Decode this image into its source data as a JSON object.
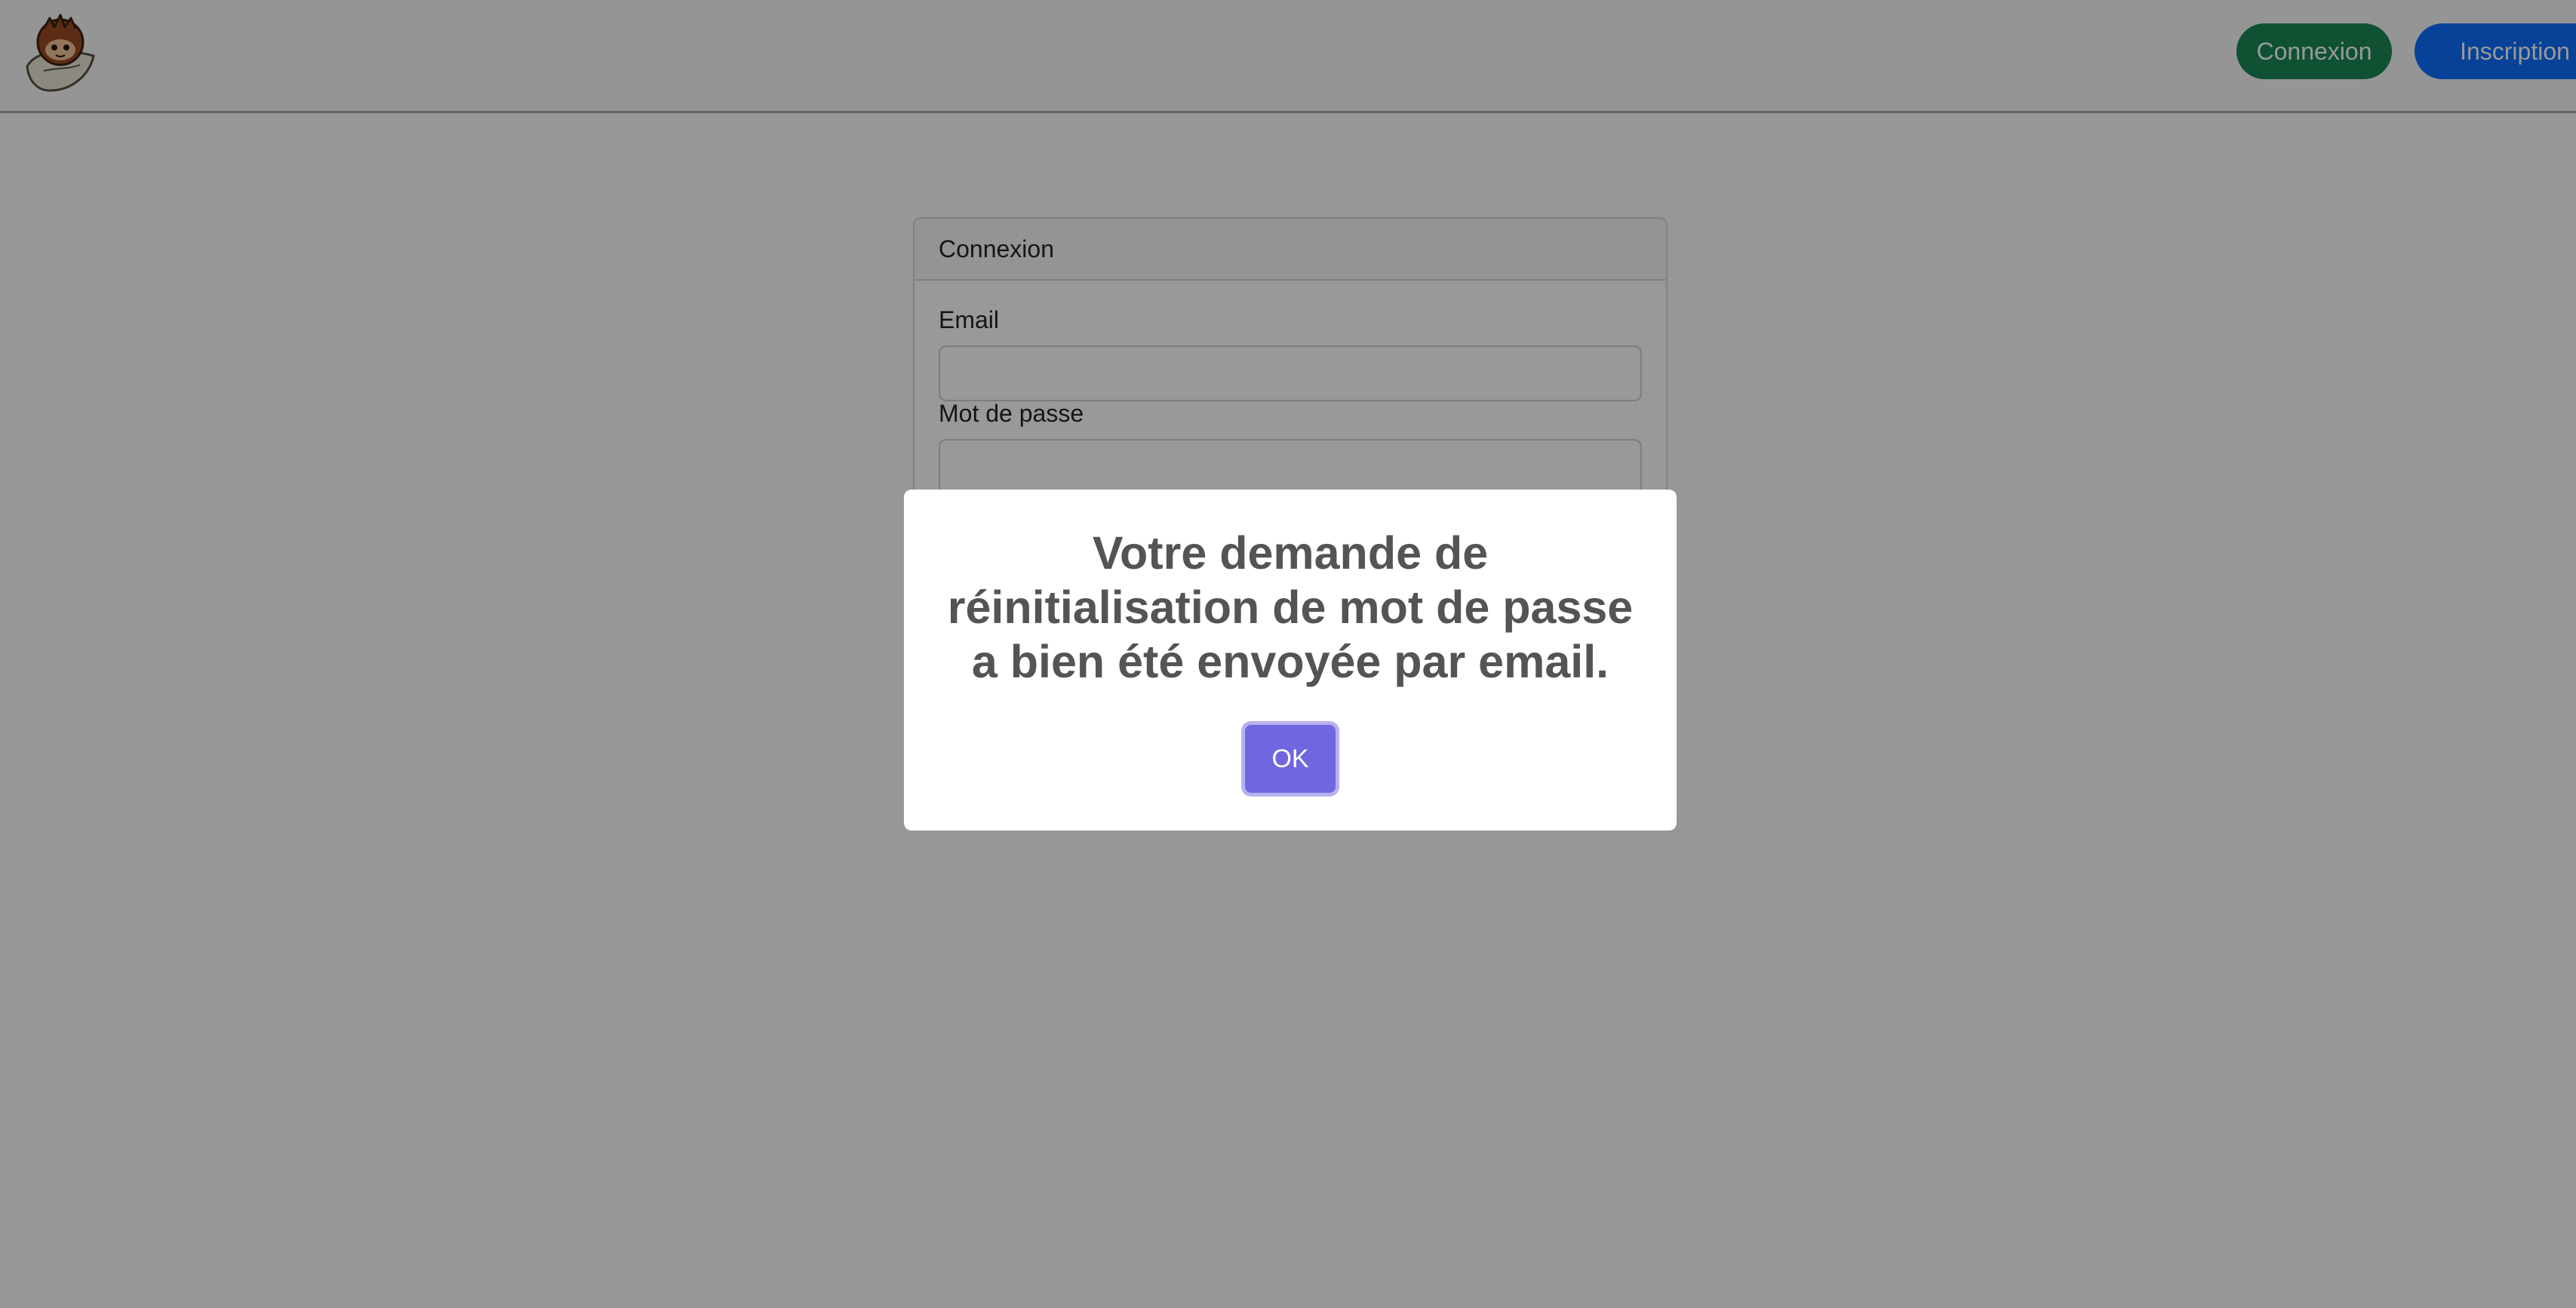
{
  "navbar": {
    "logo_icon": "owl-mascot-icon",
    "login_label": "Connexion",
    "register_label": "Inscription",
    "colors": {
      "login": "#198754",
      "register": "#0d6efd"
    }
  },
  "login_card": {
    "header": "Connexion",
    "email_label": "Email",
    "email_value": "",
    "password_label": "Mot de passe",
    "password_value": ""
  },
  "modal": {
    "title": "Votre demande de réinitialisation de mot de passe a bien été envoyée par email.",
    "ok_label": "OK",
    "confirm_color": "#7066e0"
  }
}
